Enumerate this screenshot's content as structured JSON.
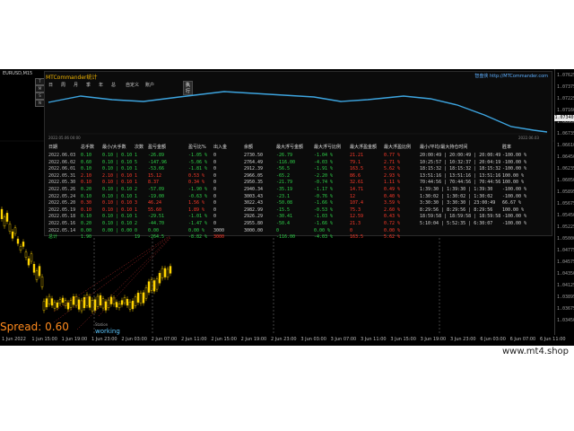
{
  "chart": {
    "symbol": "EURUSD,M15",
    "side_buttons": [
      "T",
      "M",
      "S",
      "N"
    ],
    "price_labels": [
      "1.07625",
      "1.07375",
      "1.07225",
      "1.07160",
      "1.06960",
      "1.06735",
      "1.06610",
      "1.06450",
      "1.06235",
      "1.06050",
      "1.05895",
      "1.05675",
      "1.05450",
      "1.05225",
      "1.05000",
      "1.04775",
      "1.04575",
      "1.04350",
      "1.04125",
      "1.03895",
      "1.03675",
      "1.03450"
    ],
    "current_price": "1.07340",
    "time_labels": [
      "1 Jun 2022",
      "1 Jun 15:00",
      "1 Jun 19:00",
      "1 Jun 23:00",
      "2 Jun 03:00",
      "2 Jun 07:00",
      "2 Jun 11:00",
      "2 Jun 15:00",
      "2 Jun 19:00",
      "2 Jun 23:00",
      "3 Jun 03:00",
      "3 Jun 07:00",
      "3 Jun 11:00",
      "3 Jun 15:00",
      "3 Jun 19:00",
      "3 Jun 23:00",
      "6 Jun 03:00",
      "6 Jun 07:00",
      "6 Jun 11:00"
    ],
    "spread": "Spread: 0.60",
    "status_small": "Station",
    "status": "working",
    "colors": {
      "up_candle": "#ffd400",
      "down_candle": "#ffd400",
      "curve": "#3da5e0",
      "accent": "#ff8a1c"
    }
  },
  "panel": {
    "title": "MTCommander统计",
    "link": "智盘侠 http://MTCommander.com",
    "toolbar": [
      "日",
      "周",
      "月",
      "季",
      "年",
      "总",
      "自定义",
      "账户"
    ],
    "active_tab": "执行",
    "curve_start_label": "2022.05.06 00:00",
    "curve_end_label": "2022.06.03",
    "headers": [
      "日期",
      "总手数",
      "最小/大手数",
      "次数",
      "盈亏金额",
      "盈亏比%",
      "出入金",
      "余额",
      "最大浮亏金额",
      "最大浮亏比例",
      "最大浮盈金额",
      "最大浮盈比例",
      "最小/平均/最大持仓时间",
      "胜率"
    ],
    "rows": [
      {
        "cells": [
          "2022.06.03",
          "0.10",
          "0.10 | 0.10",
          "1",
          "-26.89",
          "-1.05 %",
          "0",
          "2730.50",
          "-26.79",
          "-1.04 %",
          "21.21",
          "0.77 %",
          "20:00:49 | 20:00:49 | 20:00:49",
          "-100.00 %"
        ],
        "pos": false
      },
      {
        "cells": [
          "2022.06.02",
          "0.60",
          "0.10 | 0.10",
          "5",
          "-147.96",
          "-5.06 %",
          "0",
          "2764.49",
          "-116.00",
          "-4.03 %",
          "79.1",
          "2.71 %",
          "10:25:57 | 10:32:37 | 20:04:19",
          "-100.00 %"
        ],
        "pos": false
      },
      {
        "cells": [
          "2022.06.01",
          "0.10",
          "0.10 | 0.10",
          "1",
          "-53.66",
          "-1.81 %",
          "0",
          "2912.39",
          "-56.5",
          "-1.91 %",
          "163.5",
          "5.62 %",
          "18:15:32 | 18:15:32 | 18:15:32",
          "-100.00 %"
        ],
        "pos": false
      },
      {
        "cells": [
          "2022.05.31",
          "2.10",
          "2.10 | 0.10",
          "1",
          "15.12",
          "0.53 %",
          "0",
          "2966.05",
          "-65.2",
          "-2.20 %",
          "86.6",
          "2.93 %",
          "13:51:16 | 13:51:16 | 13:51:16",
          "100.00 %"
        ],
        "pos": true
      },
      {
        "cells": [
          "2022.05.30",
          "0.10",
          "0.10 | 0.10",
          "1",
          "8.37",
          "0.34 %",
          "0",
          "2950.35",
          "-21.79",
          "-0.74 %",
          "32.61",
          "1.11 %",
          "70:44:56 | 70:44:56 | 70:44:56",
          "100.00 %"
        ],
        "pos": true
      },
      {
        "cells": [
          "2022.05.26",
          "0.20",
          "0.10 | 0.10",
          "2",
          "-57.09",
          "-1.90 %",
          "0",
          "2940.34",
          "-35.19",
          "-1.17 %",
          "14.71",
          "0.49 %",
          "1:39:30 | 1:39:30 | 1:39:30",
          "-100.00 %"
        ],
        "pos": false
      },
      {
        "cells": [
          "2022.05.24",
          "0.10",
          "0.10 | 0.10",
          "1",
          "-19.00",
          "-0.63 %",
          "0",
          "3003.43",
          "-23.1",
          "-0.76 %",
          "12",
          "0.40 %",
          "1:30:02 | 1:30:02 | 1:30:02",
          "-100.00 %"
        ],
        "pos": false
      },
      {
        "cells": [
          "2022.05.20",
          "0.30",
          "0.10 | 0.10",
          "3",
          "46.24",
          "1.56 %",
          "0",
          "3022.43",
          "-50.08",
          "-1.66 %",
          "107.4",
          "3.59 %",
          "3:30:30 | 3:30:30 | 23:00:49",
          "66.67 %"
        ],
        "pos": true
      },
      {
        "cells": [
          "2022.05.19",
          "0.10",
          "0.10 | 0.10",
          "1",
          "55.60",
          "1.89 %",
          "0",
          "2982.99",
          "-15.5",
          "-0.53 %",
          "75.3",
          "2.60 %",
          "8:29:56 | 8:29:56 | 8:29:56",
          "100.00 %"
        ],
        "pos": true
      },
      {
        "cells": [
          "2022.05.18",
          "0.10",
          "0.10 | 0.10",
          "1",
          "-29.51",
          "-1.01 %",
          "0",
          "2926.29",
          "-30.41",
          "-1.03 %",
          "12.59",
          "0.43 %",
          "18:59:58 | 18:59:58 | 18:59:58",
          "-100.00 %"
        ],
        "pos": false
      },
      {
        "cells": [
          "2022.05.16",
          "0.20",
          "0.10 | 0.10",
          "2",
          "-44.70",
          "-1.47 %",
          "0",
          "2955.80",
          "-50.4",
          "-1.66 %",
          "21.3",
          "0.72 %",
          "5:10:04 | 5:52:35 | 6:30:07",
          "-100.00 %"
        ],
        "pos": false
      },
      {
        "cells": [
          "2022.05.14",
          "0.00",
          "0.00 | 0.00",
          "0",
          "0.00",
          "0.00 %",
          "3000",
          "3000.00",
          "0",
          "0.00 %",
          "0",
          "0.00 %",
          "",
          ""
        ],
        "pos": false
      }
    ],
    "total": [
      "总计",
      "1.90",
      "",
      "19",
      "-264.5",
      "-8.82 %",
      "3000",
      "",
      "-116.00",
      "-4.03 %",
      "163.5",
      "5.62 %",
      "",
      ""
    ]
  },
  "watermark": "www.mt4.shop"
}
